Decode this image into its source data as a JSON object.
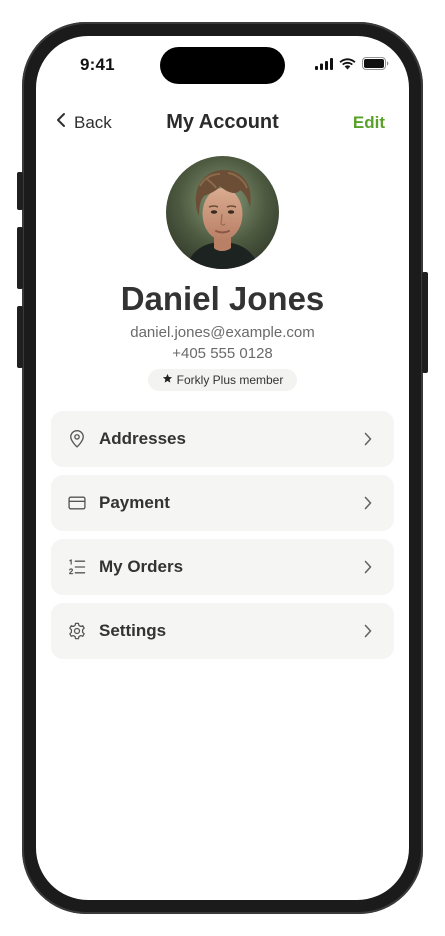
{
  "status_bar": {
    "time": "9:41",
    "icons": [
      "cellular-signal-icon",
      "wifi-icon",
      "battery-icon"
    ]
  },
  "nav": {
    "back_label": "Back",
    "title": "My Account",
    "edit_label": "Edit"
  },
  "profile": {
    "name": "Daniel Jones",
    "email": "daniel.jones@example.com",
    "phone": "+405 555 0128",
    "badge_label": "Forkly Plus member",
    "badge_icon": "star-icon"
  },
  "menu": {
    "items": [
      {
        "label": "Addresses",
        "icon": "map-pin-icon"
      },
      {
        "label": "Payment",
        "icon": "credit-card-icon"
      },
      {
        "label": "My Orders",
        "icon": "ordered-list-icon"
      },
      {
        "label": "Settings",
        "icon": "gear-icon"
      }
    ]
  },
  "colors": {
    "accent": "#5aa12a",
    "card_background": "#f5f6f3",
    "text_primary": "#333333",
    "text_secondary": "#6a6a6a"
  }
}
